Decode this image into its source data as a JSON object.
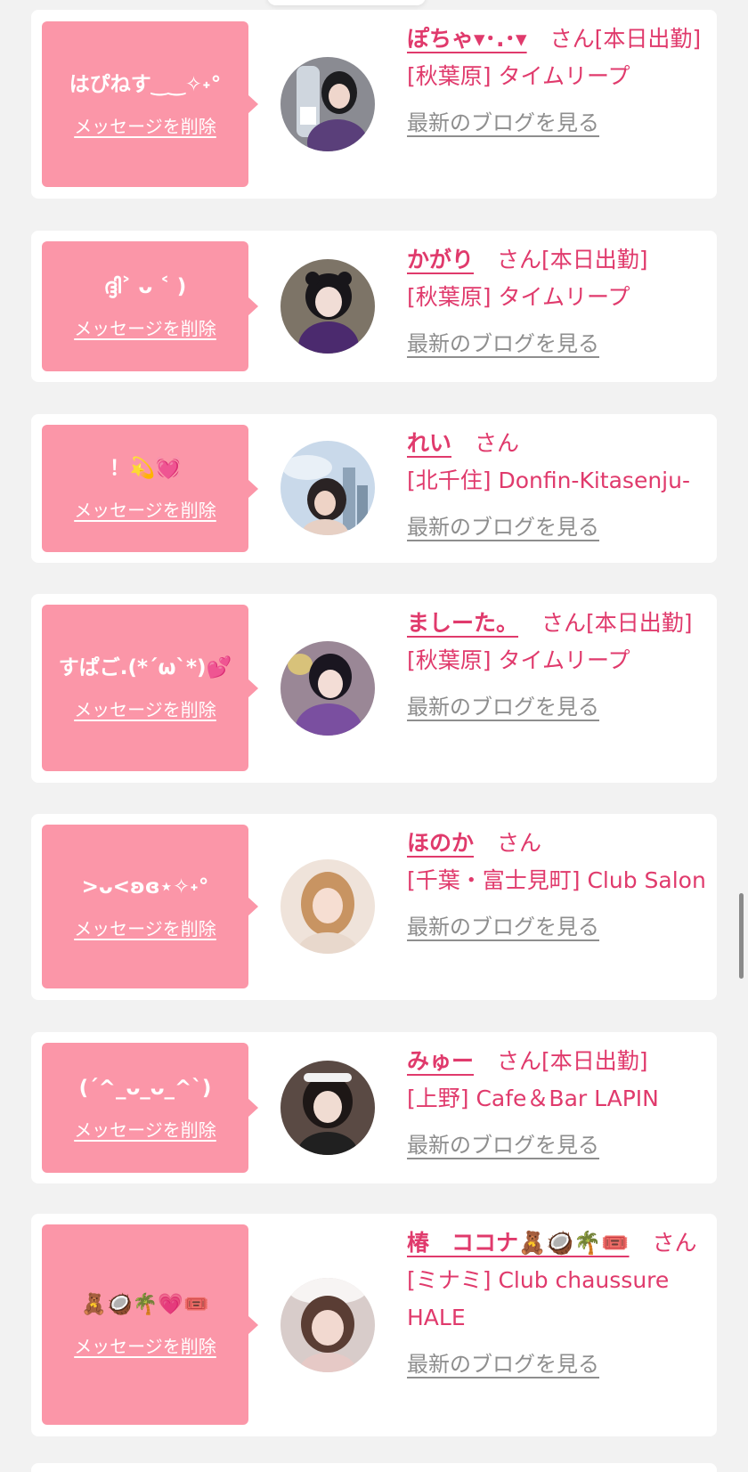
{
  "colors": {
    "page_background": "#f2f2f2",
    "bubble": "#fb96a8",
    "accent": "#e03a6c",
    "blog_link": "#8e8e8e"
  },
  "items": [
    {
      "message": "はぴねす‿‿✧˖°",
      "delete_label": "メッセージを削除",
      "name": "ぽちゃ▾･.･▾",
      "san": "さん",
      "tag": "[本日出勤]",
      "shop": "[秋葉原] タイムリープ",
      "blog_label": "最新のブログを見る",
      "avatar": "cast-photo-icon"
    },
    {
      "message": "ദ്ദി˃ ᴗ ˂ )",
      "delete_label": "メッセージを削除",
      "name": "かがり",
      "san": "さん",
      "tag": "[本日出勤]",
      "shop": "[秋葉原] タイムリープ",
      "blog_label": "最新のブログを見る",
      "avatar": "cast-photo-icon"
    },
    {
      "message": "！💫💓",
      "delete_label": "メッセージを削除",
      "name": "れい",
      "san": "さん",
      "tag": "",
      "shop": "[北千住] Donfin-Kitasenju-",
      "blog_label": "最新のブログを見る",
      "avatar": "cast-photo-icon"
    },
    {
      "message": "すぱご.(*´ω`*)💕",
      "delete_label": "メッセージを削除",
      "name": "ましーた。",
      "san": "さん",
      "tag": "[本日出勤]",
      "shop": "[秋葉原] タイムリープ",
      "blog_label": "最新のブログを見る",
      "avatar": "cast-photo-icon"
    },
    {
      "message": ">ᴗ<ʚɞ⋆✧˖°",
      "delete_label": "メッセージを削除",
      "name": "ほのか",
      "san": "さん",
      "tag": "",
      "shop": "[千葉・富士見町] Club Salon",
      "blog_label": "最新のブログを見る",
      "avatar": "cast-photo-icon"
    },
    {
      "message": "(ˊ^_ᴗ_ᴗ_^ˋ)",
      "delete_label": "メッセージを削除",
      "name": "みゅー",
      "san": "さん",
      "tag": "[本日出勤]",
      "shop": "[上野] Cafe＆Bar LAPIN",
      "blog_label": "最新のブログを見る",
      "avatar": "cast-photo-icon"
    },
    {
      "message": "🧸🥥🌴💗🎟️",
      "delete_label": "メッセージを削除",
      "name": "椿　ココナ🧸🥥🌴🎟️",
      "san": "さん",
      "tag": "",
      "shop": "[ミナミ] Club chaussure HALE",
      "blog_label": "最新のブログを見る",
      "avatar": "cast-photo-icon"
    }
  ]
}
